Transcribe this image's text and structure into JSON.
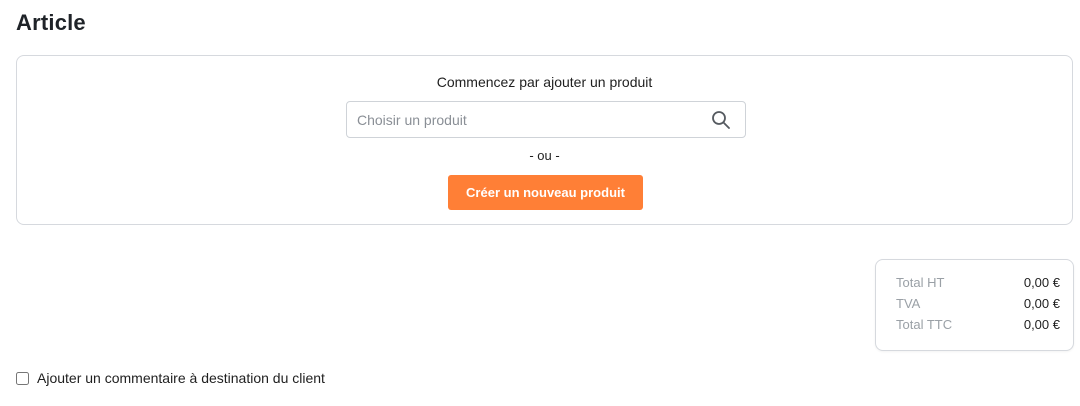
{
  "section": {
    "title": "Article"
  },
  "article_card": {
    "prompt": "Commencez par ajouter un produit",
    "search": {
      "placeholder": "Choisir un produit",
      "value": "",
      "icon": "search-icon"
    },
    "separator": "- ou -",
    "create_button_label": "Créer un nouveau produit",
    "accent_color": "#ff7f36"
  },
  "totals": [
    {
      "label": "Total HT",
      "value": "0,00 €"
    },
    {
      "label": "TVA",
      "value": "0,00 €"
    },
    {
      "label": "Total TTC",
      "value": "0,00 €"
    }
  ],
  "comment": {
    "label": "Ajouter un commentaire à destination du client",
    "checked": false
  }
}
